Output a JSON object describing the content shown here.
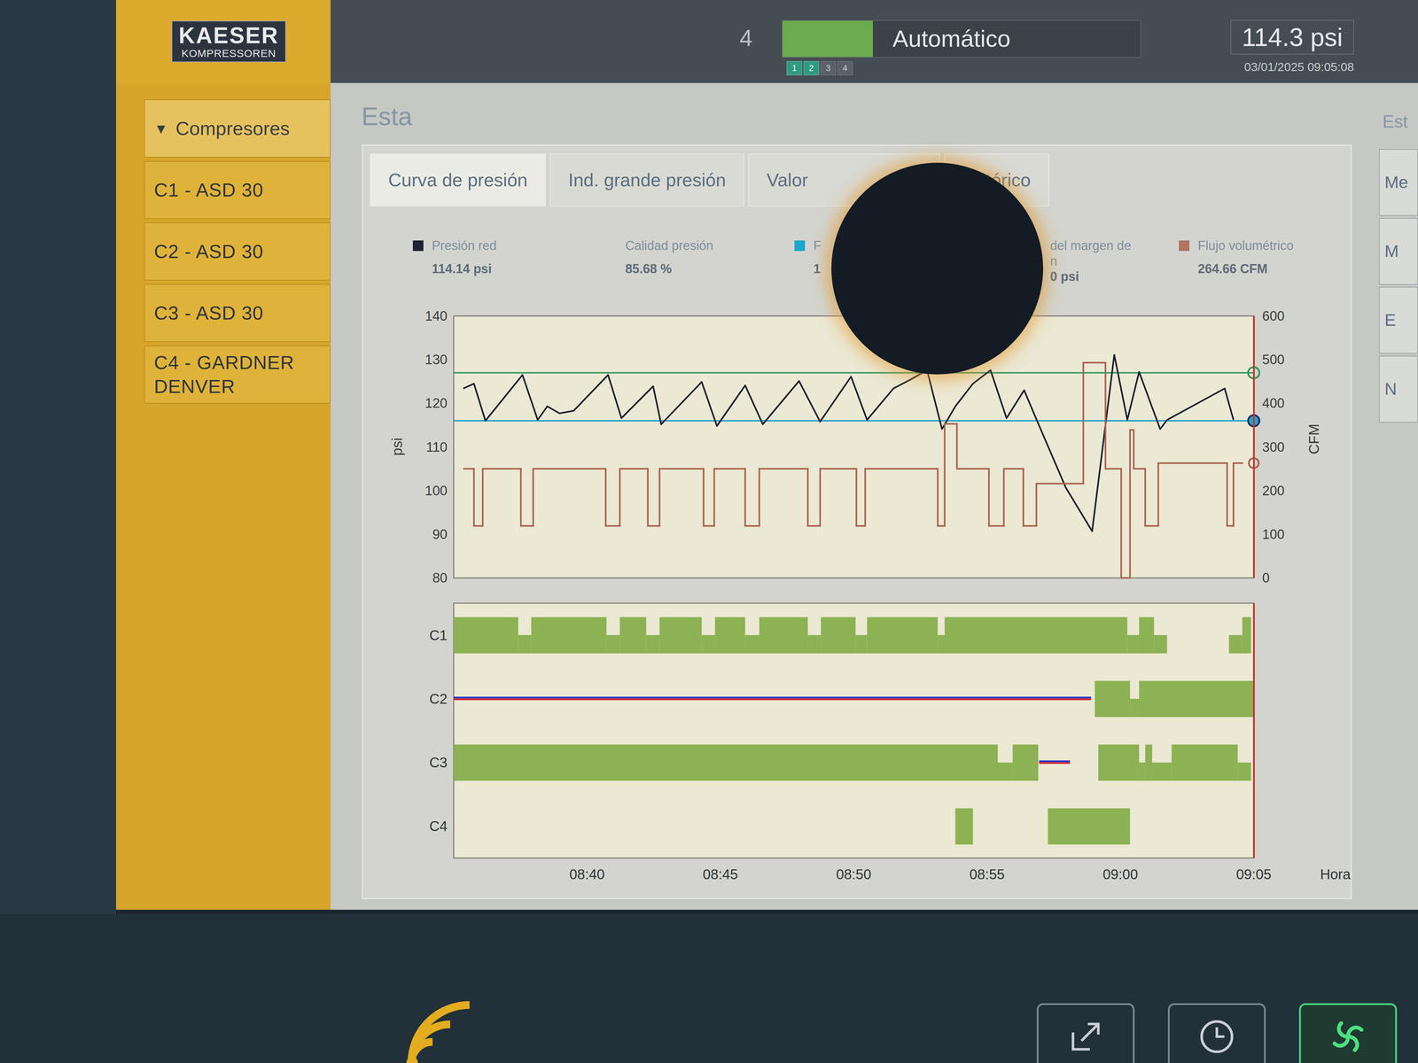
{
  "header": {
    "logo": {
      "brand": "KAESER",
      "subtitle": "KOMPRESSOREN"
    },
    "station_count": "4",
    "mode": "Automático",
    "mode_active": true,
    "indicators": [
      {
        "label": "1",
        "active": true
      },
      {
        "label": "2",
        "active": true
      },
      {
        "label": "3",
        "active": false
      },
      {
        "label": "4",
        "active": false
      }
    ],
    "pressure": "114.3 psi",
    "datetime": "03/01/2025 09:05:08"
  },
  "sidebar": {
    "group": {
      "icon": "▼",
      "label": "Compresores",
      "expanded": true
    },
    "items": [
      {
        "label": "C1 - ASD 30",
        "selected": false
      },
      {
        "label": "C2 - ASD 30",
        "selected": false
      },
      {
        "label": "C3 - ASD 30",
        "selected": false
      },
      {
        "label": "C4 - GARDNER DENVER",
        "selected": false
      }
    ]
  },
  "page_title": "Esta",
  "tabs": [
    {
      "label": "Curva de presión",
      "selected": true
    },
    {
      "label": "Ind. grande presión",
      "selected": false
    },
    {
      "label": "Valor",
      "selected": false
    },
    {
      "label": "histórico",
      "selected": false
    }
  ],
  "legend": [
    {
      "label": "Presión red",
      "value": "114.14 psi",
      "color": "#1c2333"
    },
    {
      "label": "Calidad presión",
      "value": "85.68 %"
    },
    {
      "label": "F",
      "value": "1",
      "color": "#1ba7cb"
    },
    {
      "label": "del margen de",
      "label2": "n",
      "value": "0 psi"
    },
    {
      "label": "Flujo volumétrico",
      "value": "264.66 CFM",
      "color": "#b07460"
    }
  ],
  "chart": {
    "pressure_axis": {
      "label": "psi",
      "min": 80,
      "max": 140,
      "ticks": [
        {
          "label": "140",
          "value": 140
        },
        {
          "label": "130",
          "value": 130
        },
        {
          "label": "120",
          "value": 120
        },
        {
          "label": "110",
          "value": 110
        },
        {
          "label": "100",
          "value": 100
        },
        {
          "label": "90",
          "value": 90
        },
        {
          "label": "80",
          "value": 80
        }
      ]
    },
    "flow_axis": {
      "label": "CFM",
      "min": 0,
      "max": 600,
      "ticks": [
        {
          "label": "600",
          "value": 600
        },
        {
          "label": "500",
          "value": 500
        },
        {
          "label": "400",
          "value": 400
        },
        {
          "label": "300",
          "value": 300
        },
        {
          "label": "200",
          "value": 200
        },
        {
          "label": "100",
          "value": 100
        },
        {
          "label": "0",
          "value": 0
        }
      ]
    },
    "time_axis": {
      "label": "Hora",
      "min": 0,
      "max": 30,
      "ticks": [
        {
          "label": "08:40",
          "t": 5
        },
        {
          "label": "08:45",
          "t": 10
        },
        {
          "label": "08:50",
          "t": 15
        },
        {
          "label": "08:55",
          "t": 20
        },
        {
          "label": "09:00",
          "t": 25
        },
        {
          "label": "09:05",
          "t": 30
        }
      ]
    },
    "limits": [
      {
        "value": 127,
        "color": "#2f9a5c"
      },
      {
        "value": 116,
        "color": "#1ba3cf"
      }
    ],
    "series": [
      {
        "axis": "pressure",
        "kind": "line",
        "color": "#1b1f2e",
        "t": [
          0.36,
          0.76,
          1.19,
          2.58,
          3.15,
          3.51,
          3.97,
          4.5,
          5.79,
          6.29,
          7.48,
          7.78,
          9.3,
          9.87,
          10.93,
          11.59,
          12.95,
          13.74,
          14.9,
          15.5,
          16.49,
          17.15,
          17.75,
          18.31,
          18.81,
          19.47,
          20.13,
          20.73,
          21.39,
          21.79,
          22.95,
          23.94,
          24.77,
          25.26,
          25.7,
          26.49,
          26.75,
          28.91,
          29.24
        ],
        "v": [
          123.4,
          124.5,
          116,
          126.5,
          116.2,
          119.3,
          117.7,
          118.3,
          126.5,
          116.6,
          123.9,
          115.2,
          124.9,
          114.8,
          124.1,
          115.2,
          125.1,
          115.8,
          126.1,
          116.2,
          123.4,
          125.5,
          127.6,
          114.1,
          119.3,
          124.5,
          127.6,
          116.6,
          123,
          117.2,
          100.7,
          90.7,
          131.1,
          116.2,
          127.2,
          114.1,
          116.2,
          123.4,
          116.2
        ]
      },
      {
        "axis": "flow",
        "kind": "step",
        "color": "#a8634c",
        "end": 29.6,
        "t": [
          0.36,
          0.76,
          1.09,
          2.52,
          2.98,
          5.7,
          6.23,
          7.28,
          7.72,
          9.37,
          9.77,
          10.93,
          11.46,
          13.28,
          13.74,
          15.1,
          15.43,
          18.15,
          18.41,
          18.87,
          20.07,
          20.63,
          21.36,
          21.85,
          23.61,
          24.44,
          25.03,
          25.36,
          25.5,
          25.93,
          26.42,
          29.0,
          29.24
        ],
        "v": [
          250,
          119,
          250,
          119,
          250,
          119,
          250,
          119,
          250,
          119,
          250,
          119,
          250,
          119,
          250,
          119,
          250,
          119,
          353,
          250,
          119,
          250,
          119,
          216,
          493,
          250,
          0,
          339,
          250,
          119,
          263,
          119,
          263
        ]
      }
    ]
  },
  "timeline": {
    "rows": [
      {
        "label": "C1",
        "segments": [
          {
            "from": 0,
            "to": 2.42,
            "kind": "load"
          },
          {
            "from": 2.42,
            "to": 2.91,
            "kind": "idle"
          },
          {
            "from": 2.91,
            "to": 5.73,
            "kind": "load"
          },
          {
            "from": 5.73,
            "to": 6.23,
            "kind": "idle"
          },
          {
            "from": 6.23,
            "to": 7.22,
            "kind": "load"
          },
          {
            "from": 7.22,
            "to": 7.72,
            "kind": "idle"
          },
          {
            "from": 7.72,
            "to": 9.3,
            "kind": "load"
          },
          {
            "from": 9.3,
            "to": 9.8,
            "kind": "idle"
          },
          {
            "from": 9.8,
            "to": 10.93,
            "kind": "load"
          },
          {
            "from": 10.93,
            "to": 11.46,
            "kind": "idle"
          },
          {
            "from": 11.46,
            "to": 13.28,
            "kind": "load"
          },
          {
            "from": 13.28,
            "to": 13.77,
            "kind": "idle"
          },
          {
            "from": 13.77,
            "to": 15.07,
            "kind": "load"
          },
          {
            "from": 15.07,
            "to": 15.5,
            "kind": "idle"
          },
          {
            "from": 15.5,
            "to": 18.15,
            "kind": "load"
          },
          {
            "from": 18.15,
            "to": 18.41,
            "kind": "idle"
          },
          {
            "from": 18.41,
            "to": 25.26,
            "kind": "load"
          },
          {
            "from": 25.26,
            "to": 25.7,
            "kind": "idle"
          },
          {
            "from": 25.7,
            "to": 26.26,
            "kind": "load"
          },
          {
            "from": 26.26,
            "to": 26.75,
            "kind": "idle"
          },
          {
            "from": 29.07,
            "to": 29.57,
            "kind": "idle"
          },
          {
            "from": 29.57,
            "to": 29.9,
            "kind": "load"
          }
        ]
      },
      {
        "label": "C2",
        "segments": [
          {
            "from": 0,
            "to": 23.9,
            "kind": "fault"
          },
          {
            "from": 24.04,
            "to": 25.36,
            "kind": "load"
          },
          {
            "from": 25.36,
            "to": 25.7,
            "kind": "idle"
          },
          {
            "from": 25.7,
            "to": 30,
            "kind": "load"
          }
        ]
      },
      {
        "label": "C3",
        "segments": [
          {
            "from": 0,
            "to": 20.4,
            "kind": "load"
          },
          {
            "from": 20.4,
            "to": 20.96,
            "kind": "idle"
          },
          {
            "from": 20.96,
            "to": 21.92,
            "kind": "load"
          },
          {
            "from": 21.95,
            "to": 23.11,
            "kind": "fault"
          },
          {
            "from": 24.17,
            "to": 25.7,
            "kind": "load"
          },
          {
            "from": 25.7,
            "to": 25.93,
            "kind": "idle"
          },
          {
            "from": 25.93,
            "to": 26.19,
            "kind": "load"
          },
          {
            "from": 26.19,
            "to": 26.92,
            "kind": "idle"
          },
          {
            "from": 26.92,
            "to": 29.4,
            "kind": "load"
          },
          {
            "from": 29.4,
            "to": 29.9,
            "kind": "idle"
          }
        ]
      },
      {
        "label": "C4",
        "segments": [
          {
            "from": 18.81,
            "to": 19.47,
            "kind": "load"
          },
          {
            "from": 22.28,
            "to": 25.36,
            "kind": "load"
          }
        ]
      }
    ]
  },
  "right_panel": {
    "title": "Est",
    "buttons": [
      "Me",
      "M",
      "E",
      "N"
    ]
  },
  "keys": [
    {
      "lit": false
    },
    {
      "lit": false
    },
    {
      "lit": true
    }
  ]
}
